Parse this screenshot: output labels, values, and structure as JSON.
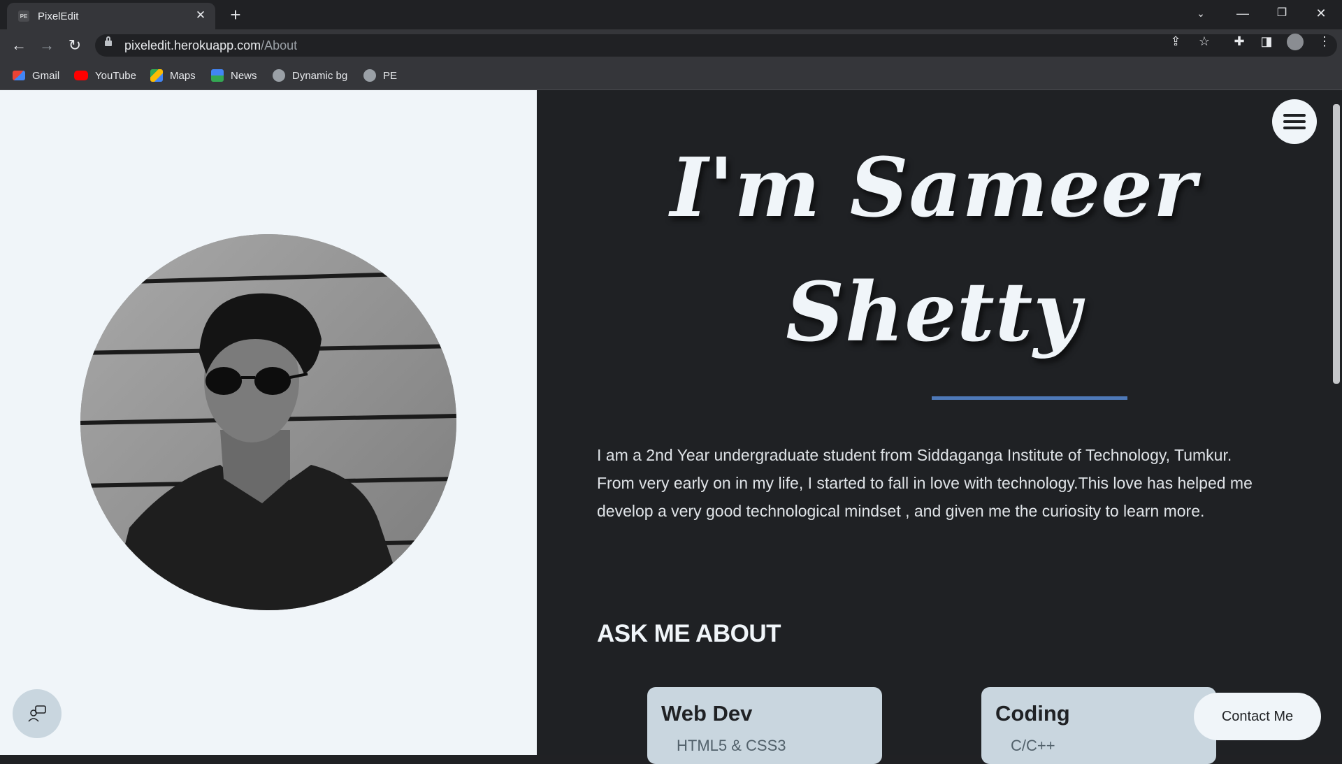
{
  "browser": {
    "tab_title": "PixelEdit",
    "tab_favicon_text": "PE",
    "url_host": "pixeledit.herokuapp.com",
    "url_path": "/About",
    "bookmarks": [
      "Gmail",
      "YouTube",
      "Maps",
      "News",
      "Dynamic bg",
      "PE"
    ]
  },
  "page": {
    "name_line1": "I'm Sameer",
    "name_line2": "Shetty",
    "bio": "I am a 2nd Year undergraduate student from Siddaganga Institute of Technology, Tumkur. From very early on in my life, I started to fall in love with technology.This love has helped me develop a very good technological mindset , and given me the curiosity to learn more.",
    "ask_heading": "ASK ME ABOUT",
    "cards": [
      {
        "title": "Web Dev",
        "item": "HTML5 & CSS3"
      },
      {
        "title": "Coding",
        "item": "C/C++"
      }
    ],
    "contact_label": "Contact Me"
  },
  "colors": {
    "light_bg": "#f0f5f9",
    "dark_bg": "#1f2124",
    "accent": "#4e79b8",
    "card_bg": "#c9d6df"
  }
}
